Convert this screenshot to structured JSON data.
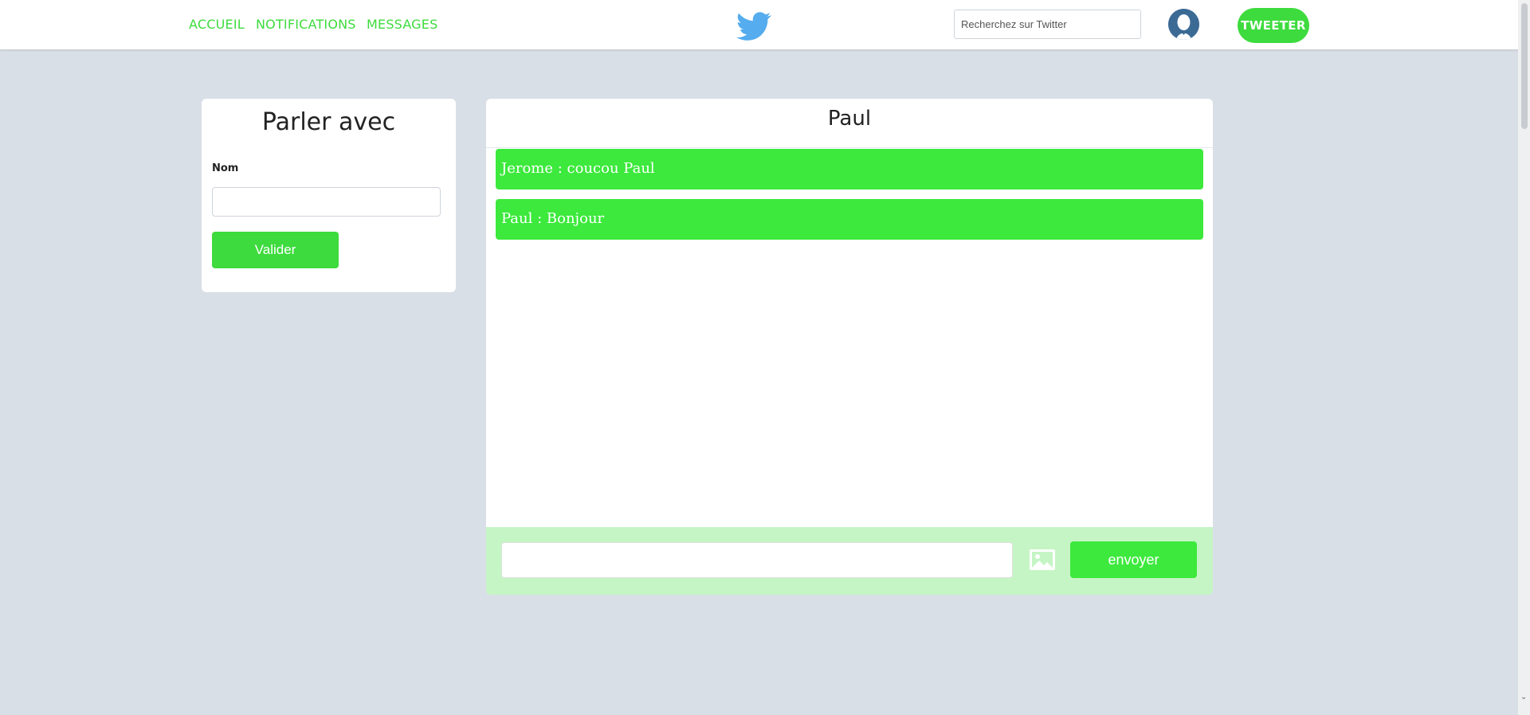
{
  "nav": {
    "links": [
      "ACCUEIL",
      "NOTIFICATIONS",
      "MESSAGES"
    ],
    "search_placeholder": "Recherchez sur Twitter",
    "tweet_label": "TWEETER",
    "logo_icon": "twitter-bird-icon",
    "avatar_icon": "user-avatar-icon"
  },
  "left_panel": {
    "title": "Parler avec",
    "name_label": "Nom",
    "name_value": "",
    "validate_label": "Valider"
  },
  "chat": {
    "title": "Paul",
    "messages": [
      "Jerome : coucou Paul",
      "Paul : Bonjour"
    ],
    "input_value": "",
    "image_icon": "image-icon",
    "send_label": "envoyer"
  },
  "colors": {
    "accent": "#3ddb3d",
    "message_bg": "#3ce93c",
    "composer_bg": "#c5f5c5",
    "page_bg": "#d9dfe6",
    "twitter_blue": "#55acee"
  }
}
